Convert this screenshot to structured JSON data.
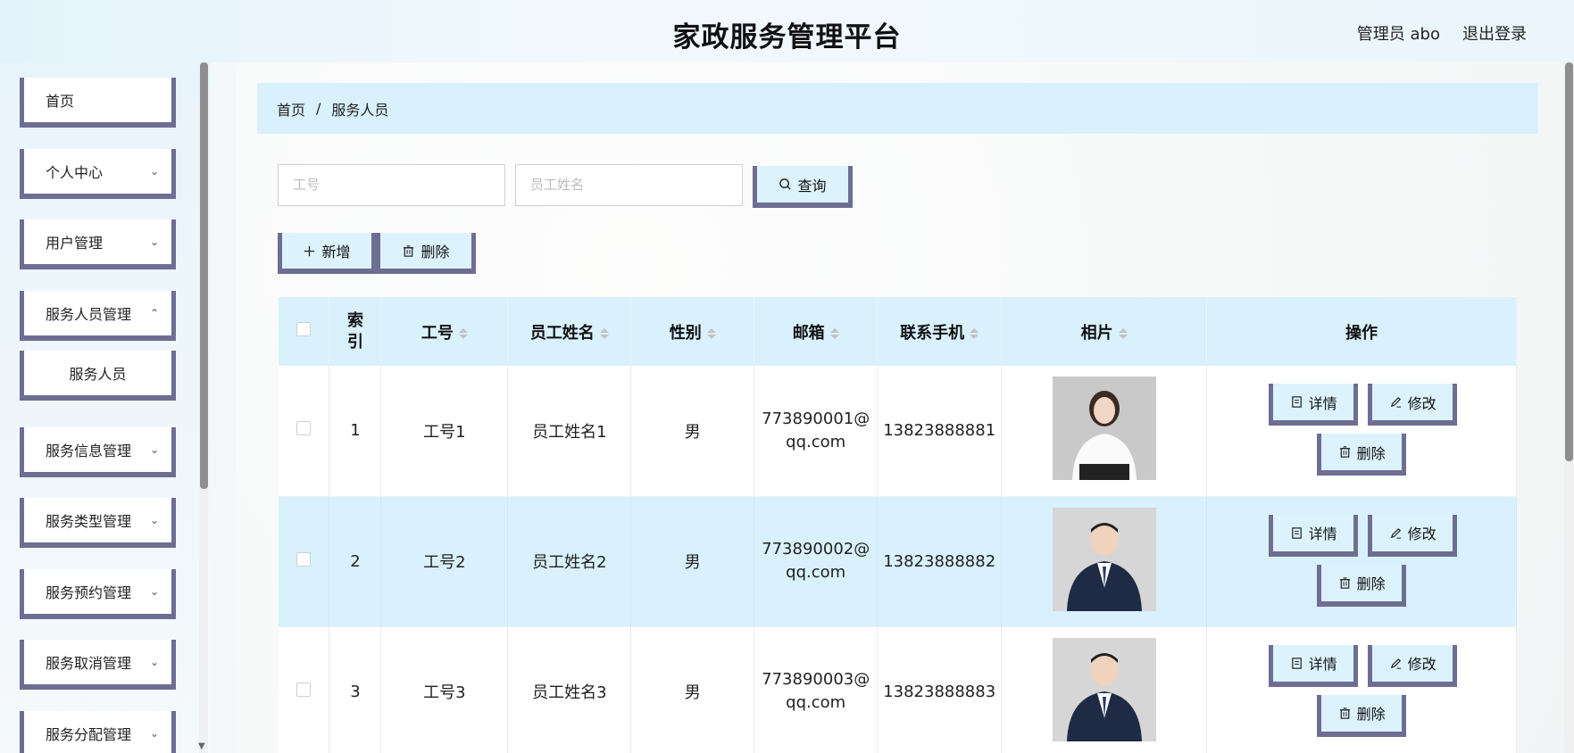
{
  "header": {
    "title": "家政服务管理平台",
    "user": "管理员 abo",
    "logout": "退出登录"
  },
  "sidebar": {
    "items": [
      {
        "label": "首页",
        "chevron": false
      },
      {
        "label": "个人中心",
        "chevron": true
      },
      {
        "label": "用户管理",
        "chevron": true
      },
      {
        "label": "服务人员管理",
        "chevron": true
      },
      {
        "label": "服务人员",
        "chevron": false,
        "sub": true
      },
      {
        "label": "服务信息管理",
        "chevron": true
      },
      {
        "label": "服务类型管理",
        "chevron": true
      },
      {
        "label": "服务预约管理",
        "chevron": true
      },
      {
        "label": "服务取消管理",
        "chevron": true
      },
      {
        "label": "服务分配管理",
        "chevron": true
      }
    ]
  },
  "breadcrumb": {
    "home": "首页",
    "separator": "/",
    "current": "服务人员"
  },
  "search": {
    "id_placeholder": "工号",
    "name_placeholder": "员工姓名",
    "query_label": "查询"
  },
  "toolbar": {
    "add_label": "新增",
    "delete_label": "删除"
  },
  "table": {
    "columns": [
      "索引",
      "工号",
      "员工姓名",
      "性别",
      "邮箱",
      "联系手机",
      "相片",
      "操作"
    ],
    "rows": [
      {
        "index": "1",
        "id": "工号1",
        "name": "员工姓名1",
        "gender": "男",
        "email_line1": "773890001@",
        "email_line2": "qq.com",
        "phone": "13823888881",
        "photo": "female-portrait"
      },
      {
        "index": "2",
        "id": "工号2",
        "name": "员工姓名2",
        "gender": "男",
        "email_line1": "773890002@",
        "email_line2": "qq.com",
        "phone": "13823888882",
        "photo": "male-portrait"
      },
      {
        "index": "3",
        "id": "工号3",
        "name": "员工姓名3",
        "gender": "男",
        "email_line1": "773890003@",
        "email_line2": "qq.com",
        "phone": "13823888883",
        "photo": "male-portrait"
      }
    ],
    "actions": {
      "detail": "详情",
      "edit": "修改",
      "delete": "删除"
    }
  },
  "colors": {
    "accent_light": "#d8f1fc",
    "border_dark": "#6e6e93"
  }
}
